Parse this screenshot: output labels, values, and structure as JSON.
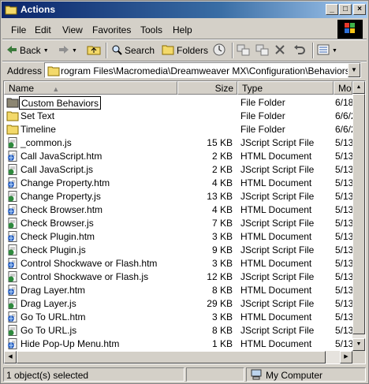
{
  "window": {
    "title": "Actions"
  },
  "menu": [
    "File",
    "Edit",
    "View",
    "Favorites",
    "Tools",
    "Help"
  ],
  "toolbar": {
    "back": "Back",
    "search": "Search",
    "folders": "Folders"
  },
  "address": {
    "label": "Address",
    "value": "rogram Files\\Macromedia\\Dreamweaver MX\\Configuration\\Behaviors\\Actions"
  },
  "columns": {
    "name": "Name",
    "size": "Size",
    "type": "Type",
    "modified": "Modi"
  },
  "files": [
    {
      "name": "Custom Behaviors",
      "size": "",
      "type": "File Folder",
      "modified": "6/18",
      "icon": "folder-dark",
      "renaming": true
    },
    {
      "name": "Set Text",
      "size": "",
      "type": "File Folder",
      "modified": "6/6/2",
      "icon": "folder"
    },
    {
      "name": "Timeline",
      "size": "",
      "type": "File Folder",
      "modified": "6/6/2",
      "icon": "folder"
    },
    {
      "name": "_common.js",
      "size": "15 KB",
      "type": "JScript Script File",
      "modified": "5/13",
      "icon": "js"
    },
    {
      "name": "Call JavaScript.htm",
      "size": "2 KB",
      "type": "HTML Document",
      "modified": "5/13",
      "icon": "htm"
    },
    {
      "name": "Call JavaScript.js",
      "size": "2 KB",
      "type": "JScript Script File",
      "modified": "5/13",
      "icon": "js"
    },
    {
      "name": "Change Property.htm",
      "size": "4 KB",
      "type": "HTML Document",
      "modified": "5/13",
      "icon": "htm"
    },
    {
      "name": "Change Property.js",
      "size": "13 KB",
      "type": "JScript Script File",
      "modified": "5/13",
      "icon": "js"
    },
    {
      "name": "Check Browser.htm",
      "size": "4 KB",
      "type": "HTML Document",
      "modified": "5/13",
      "icon": "htm"
    },
    {
      "name": "Check Browser.js",
      "size": "7 KB",
      "type": "JScript Script File",
      "modified": "5/13",
      "icon": "js"
    },
    {
      "name": "Check Plugin.htm",
      "size": "3 KB",
      "type": "HTML Document",
      "modified": "5/13",
      "icon": "htm"
    },
    {
      "name": "Check Plugin.js",
      "size": "9 KB",
      "type": "JScript Script File",
      "modified": "5/13",
      "icon": "js"
    },
    {
      "name": "Control Shockwave or Flash.htm",
      "size": "3 KB",
      "type": "HTML Document",
      "modified": "5/13",
      "icon": "htm"
    },
    {
      "name": "Control Shockwave or Flash.js",
      "size": "12 KB",
      "type": "JScript Script File",
      "modified": "5/13",
      "icon": "js"
    },
    {
      "name": "Drag Layer.htm",
      "size": "8 KB",
      "type": "HTML Document",
      "modified": "5/13",
      "icon": "htm"
    },
    {
      "name": "Drag Layer.js",
      "size": "29 KB",
      "type": "JScript Script File",
      "modified": "5/13",
      "icon": "js"
    },
    {
      "name": "Go To URL.htm",
      "size": "3 KB",
      "type": "HTML Document",
      "modified": "5/13",
      "icon": "htm"
    },
    {
      "name": "Go To URL.js",
      "size": "8 KB",
      "type": "JScript Script File",
      "modified": "5/13",
      "icon": "js"
    },
    {
      "name": "Hide Pop-Up Menu.htm",
      "size": "1 KB",
      "type": "HTML Document",
      "modified": "5/13",
      "icon": "htm"
    }
  ],
  "status": {
    "selected": "1 object(s) selected",
    "location": "My Computer"
  }
}
